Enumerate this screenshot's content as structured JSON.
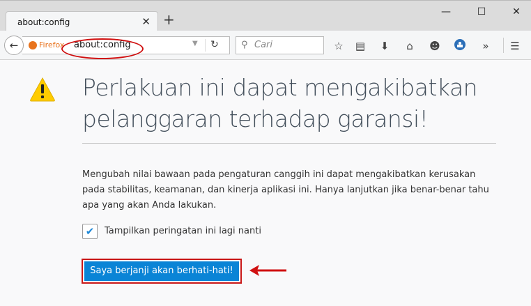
{
  "tab": {
    "title": "about:config",
    "close": "✕"
  },
  "newtab": "+",
  "window": {
    "minimize": "—",
    "maximize": "☐",
    "close": "✕"
  },
  "urlbar": {
    "identity": "Firefox",
    "value": "about:config"
  },
  "search": {
    "placeholder": "Cari"
  },
  "content": {
    "title_line1": "Perlakuan ini dapat mengakibatkan",
    "title_line2": "pelanggaran terhadap garansi!",
    "description": "Mengubah nilai bawaan pada pengaturan canggih ini dapat mengakibatkan kerusakan pada stabilitas, keamanan, dan kinerja aplikasi ini. Hanya lanjutkan jika benar-benar tahu apa yang akan Anda lakukan.",
    "checkbox_label": "Tampilkan peringatan ini lagi nanti",
    "checkbox_checked": true,
    "button_label": "Saya berjanji akan berhati-hati!"
  },
  "colors": {
    "accent": "#0a84d6",
    "annotation": "#d01010",
    "warning": "#ffcc00"
  },
  "toolbar_icons": [
    "bookmark-star-icon",
    "reading-list-icon",
    "download-icon",
    "home-icon",
    "emoji-icon",
    "extension-icon",
    "overflow-icon",
    "menu-icon"
  ]
}
